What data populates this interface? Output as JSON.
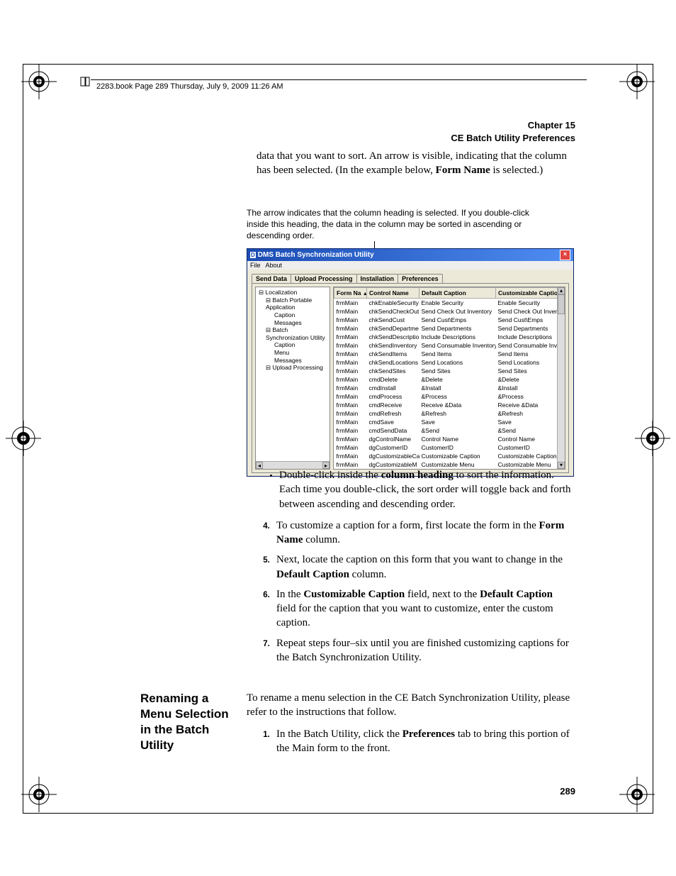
{
  "header": {
    "book_line": "2283.book  Page 289  Thursday, July 9, 2009  11:26 AM",
    "chapter_num": "Chapter 15",
    "chapter_title": "CE Batch Utility Preferences"
  },
  "intro_para_prefix": "data that you want to sort. An arrow is visible, indicating that the column has been selected. (In the example below, ",
  "intro_para_bold": "Form Name",
  "intro_para_suffix": " is selected.)",
  "caption": "The arrow indicates that the column heading is selected. If you double-click inside this heading, the data in the column may be sorted in ascending or descending order.",
  "screenshot": {
    "title": "DMS Batch Synchronization Utility",
    "menu": [
      "File",
      "About"
    ],
    "tabs": [
      "Send Data",
      "Upload Processing",
      "Installation",
      "Preferences"
    ],
    "active_tab_index": 3,
    "tree": [
      {
        "level": 0,
        "label": "Localization"
      },
      {
        "level": 1,
        "label": "Batch Portable Application"
      },
      {
        "level": 2,
        "label": "Caption"
      },
      {
        "level": 2,
        "label": "Messages"
      },
      {
        "level": 1,
        "label": "Batch Synchronization Utility"
      },
      {
        "level": 2,
        "label": "Caption"
      },
      {
        "level": 2,
        "label": "Menu"
      },
      {
        "level": 2,
        "label": "Messages"
      },
      {
        "level": 1,
        "label": "Upload Processing"
      }
    ],
    "table": {
      "columns": [
        "Form Na…",
        "Control Name",
        "Default Caption",
        "Customizable Caption"
      ],
      "rows": [
        [
          "frmMain",
          "chkEnableSecurity",
          "Enable Security",
          "Enable Security"
        ],
        [
          "frmMain",
          "chkSendCheckOut",
          "Send Check Out Inventory",
          "Send Check Out Inventory"
        ],
        [
          "frmMain",
          "chkSendCust",
          "Send Cust\\Emps",
          "Send Cust\\Emps"
        ],
        [
          "frmMain",
          "chkSendDepartme",
          "Send Departments",
          "Send Departments"
        ],
        [
          "frmMain",
          "chkSendDescriptio",
          "Include Descriptions",
          "Include Descriptions"
        ],
        [
          "frmMain",
          "chkSendInventory",
          "Send Consumable Inventory",
          "Send Consumable Inventory"
        ],
        [
          "frmMain",
          "chkSendItems",
          "Send Items",
          "Send Items"
        ],
        [
          "frmMain",
          "chkSendLocations",
          "Send Locations",
          "Send Locations"
        ],
        [
          "frmMain",
          "chkSendSites",
          "Send Sites",
          "Send Sites"
        ],
        [
          "frmMain",
          "cmdDelete",
          "&Delete",
          "&Delete"
        ],
        [
          "frmMain",
          "cmdInstall",
          "&Install",
          "&Install"
        ],
        [
          "frmMain",
          "cmdProcess",
          "&Process",
          "&Process"
        ],
        [
          "frmMain",
          "cmdReceive",
          "Receive &Data",
          "Receive &Data"
        ],
        [
          "frmMain",
          "cmdRefresh",
          "&Refresh",
          "&Refresh"
        ],
        [
          "frmMain",
          "cmdSave",
          "Save",
          "Save"
        ],
        [
          "frmMain",
          "cmdSendData",
          "&Send",
          "&Send"
        ],
        [
          "frmMain",
          "dgControlName",
          "Control Name",
          "Control Name"
        ],
        [
          "frmMain",
          "dgCustomerID",
          "CustomerID",
          "CustomerID"
        ],
        [
          "frmMain",
          "dgCustomizableCa",
          "Customizable Caption",
          "Customizable Caption"
        ],
        [
          "frmMain",
          "dgCustomizableM",
          "Customizable Menu",
          "Customizable Menu"
        ]
      ]
    }
  },
  "bullets": [
    {
      "prefix": "Double-click inside the ",
      "b": "column heading",
      "suffix": " to sort the information. Each time you double-click, the sort order will toggle back and forth between ascending and descending order."
    }
  ],
  "steps": [
    {
      "prefix": "To customize a caption for a form, first locate the form in the ",
      "b": "Form Name",
      "suffix": " column."
    },
    {
      "prefix": "Next, locate the caption on this form that you want to change in the ",
      "b": "Default Caption",
      "suffix": " column."
    },
    {
      "prefix": "In the ",
      "b": "Customizable Caption",
      "suffix": " field, next to the ",
      "b2": "Default Caption",
      "suffix2": " field for the caption that you want to customize, enter the custom caption."
    },
    {
      "prefix": "Repeat steps four–six until you are finished customizing captions for the Batch Synchronization Utility.",
      "b": "",
      "suffix": ""
    }
  ],
  "side_heading": "Renaming a Menu Selection in the Batch Utility",
  "body2_p": "To rename a menu selection in the CE Batch Synchronization Utility, please refer to the instructions that follow.",
  "body2_step": {
    "prefix": "In the Batch Utility, click the ",
    "b": "Preferences",
    "suffix": " tab to bring this portion of the Main form to the front."
  },
  "page_number": "289"
}
